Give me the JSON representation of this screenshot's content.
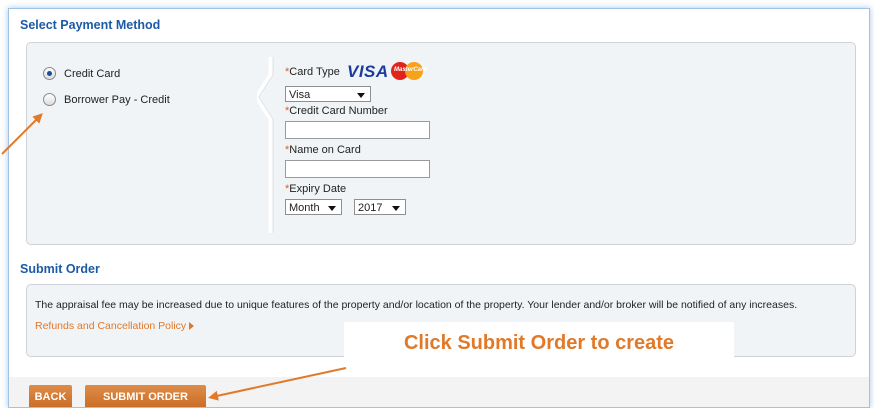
{
  "payment": {
    "title": "Select Payment Method",
    "options": [
      {
        "label": "Credit Card",
        "checked": true
      },
      {
        "label": "Borrower Pay - Credit",
        "checked": false
      }
    ],
    "card_type_label": "Card Type",
    "card_brands": {
      "visa": "VISA",
      "mastercard": "MasterCard"
    },
    "card_type_value": "Visa",
    "card_number_label": "Credit Card Number",
    "card_number_value": "",
    "name_on_card_label": "Name on Card",
    "name_on_card_value": "",
    "expiry_label": "Expiry Date",
    "expiry_month": "Month",
    "expiry_year": "2017",
    "required_marker": "*"
  },
  "submit": {
    "title": "Submit Order",
    "notice": "The appraisal fee may be increased due to unique features of the property and/or location of the property. Your lender and/or broker will be notified of any increases.",
    "policy_link": "Refunds and Cancellation Policy"
  },
  "buttons": {
    "back": "BACK",
    "submit": "SUBMIT ORDER"
  },
  "annotation": {
    "callout": "Click Submit Order to create"
  },
  "colors": {
    "accent": "#1d5aa6",
    "button": "#d67a32",
    "annotation": "#e07a2a"
  }
}
